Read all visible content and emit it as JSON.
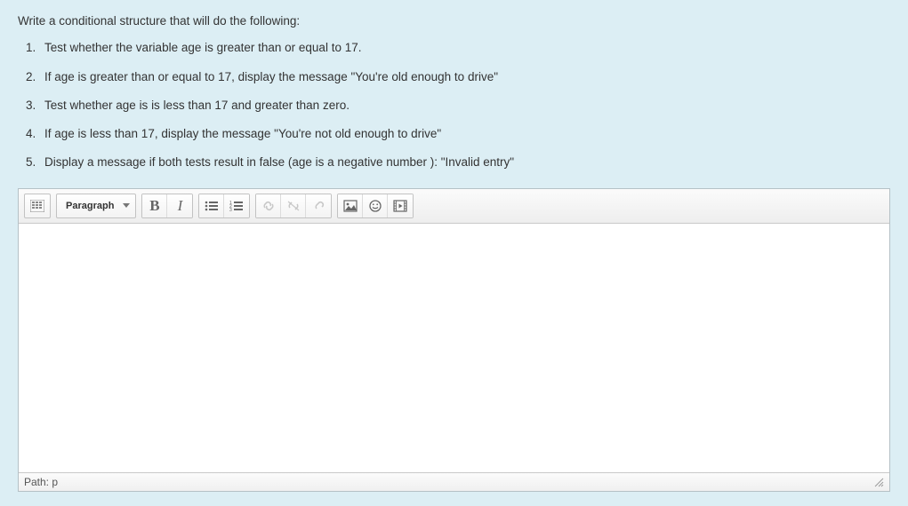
{
  "prompt": {
    "intro": "Write a conditional structure that will do the following:",
    "items": [
      "Test whether the variable age is greater than or equal to 17.",
      "If age is greater than or equal to 17, display the message \"You're old enough to drive\"",
      "Test whether age is is less than 17 and greater than zero.",
      "If age is less than 17, display the message \"You're not old enough to drive\"",
      "Display a message if both tests result in false (age is a negative number ):  \"Invalid entry\""
    ]
  },
  "toolbar": {
    "format_label": "Paragraph"
  },
  "status": {
    "path_label": "Path: p"
  }
}
